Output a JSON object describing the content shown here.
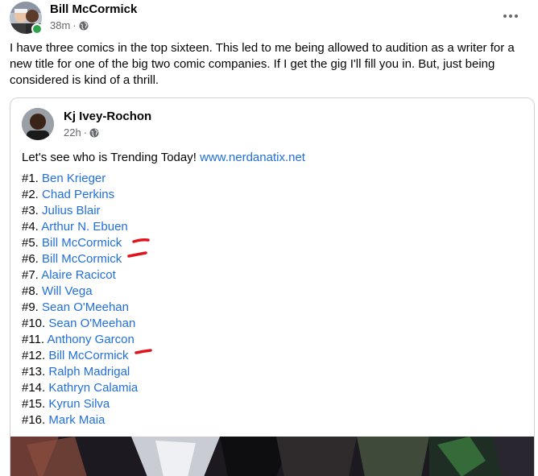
{
  "post": {
    "author": "Bill McCormick",
    "time": "38m",
    "dot": "·",
    "text": "I have three comics in the top sixteen. This led to me being allowed to audition as a writer for a new title for one of the big two comic companies. If I get the gig I'll fill you in. But, just being considered is kind of a thrill.",
    "more_icon": "more-horizontal-icon",
    "privacy_icon": "globe-icon"
  },
  "shared": {
    "author": "Kj Ivey-Rochon",
    "time": "22h",
    "dot": "·",
    "intro": "Let's see who is Trending Today!",
    "link": "www.nerdanatix.net",
    "items": [
      {
        "rank": "#1.",
        "name": "Ben Krieger"
      },
      {
        "rank": "#2.",
        "name": "Chad Perkins"
      },
      {
        "rank": "#3.",
        "name": "Julius Blair"
      },
      {
        "rank": "#4.",
        "name": "Arthur N. Ebuen"
      },
      {
        "rank": "#5.",
        "name": "Bill McCormick"
      },
      {
        "rank": "#6.",
        "name": "Bill McCormick"
      },
      {
        "rank": "#7.",
        "name": "Alaire Racicot"
      },
      {
        "rank": "#8.",
        "name": "Will Vega"
      },
      {
        "rank": "#9.",
        "name": "Sean O'Meehan"
      },
      {
        "rank": "#10.",
        "name": "Sean O'Meehan"
      },
      {
        "rank": "#11.",
        "name": "Anthony Garcon"
      },
      {
        "rank": "#12.",
        "name": "Bill McCormick"
      },
      {
        "rank": "#13.",
        "name": "Ralph Madrigal"
      },
      {
        "rank": "#14.",
        "name": "Kathryn Calamia"
      },
      {
        "rank": "#15.",
        "name": "Kyrun Silva"
      },
      {
        "rank": "#16.",
        "name": "Mark Maia"
      }
    ]
  },
  "colors": {
    "link": "#216fdb",
    "meta": "#65676b",
    "online": "#31a24c",
    "annotation": "#e0141e"
  }
}
